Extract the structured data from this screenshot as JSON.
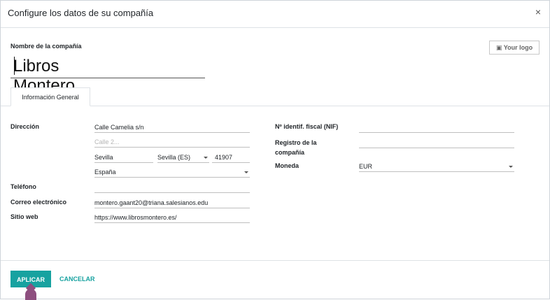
{
  "dialog": {
    "title": "Configure los datos de su compañía",
    "close_icon": "×"
  },
  "company": {
    "name_label": "Nombre de la compañía",
    "name_value": "Libros Montero",
    "logo_button": "Your logo",
    "logo_icon": "camera-icon"
  },
  "tabs": [
    {
      "label": "Información General"
    }
  ],
  "left": {
    "address_label": "Dirección",
    "street": "Calle Camelia s/n",
    "street2_placeholder": "Calle 2...",
    "city": "Sevilla",
    "state": "Sevilla (ES)",
    "zip": "41907",
    "country": "España",
    "phone_label": "Teléfono",
    "phone_value": "",
    "email_label": "Correo electrónico",
    "email_value": "montero.gaant20@triana.salesianos.edu",
    "website_label": "Sitio web",
    "website_value": "https://www.librosmontero.es/"
  },
  "right": {
    "vat_label": "Nº identif. fiscal (NIF)",
    "vat_value": "",
    "registry_label": "Registro de la compañía",
    "registry_value": "",
    "currency_label": "Moneda",
    "currency_value": "EUR"
  },
  "footer": {
    "apply_label": "APLICAR",
    "cancel_label": "CANCELAR"
  },
  "colors": {
    "accent": "#17a2a0",
    "brand": "#8e4f7f"
  }
}
